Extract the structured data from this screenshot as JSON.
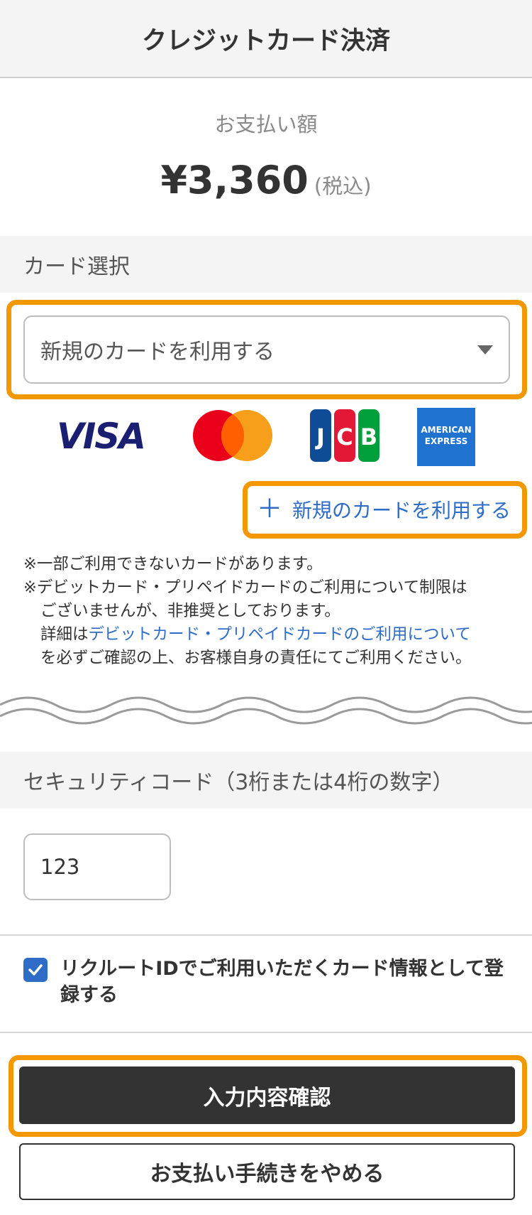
{
  "header": {
    "title": "クレジットカード決済"
  },
  "amount": {
    "label": "お支払い額",
    "value": "¥3,360",
    "tax": "(税込)"
  },
  "card_section": {
    "title": "カード選択",
    "select_value": "新規のカードを利用する",
    "brands": {
      "visa": "VISA",
      "amex_line1": "AMERICAN",
      "amex_line2": "EXPRESS"
    },
    "new_card_link": "新規のカードを利用する",
    "notes": {
      "line1": "※一部ご利用できないカードがあります。",
      "line2": "※デビットカード・プリペイドカードのご利用について制限は",
      "line3": "ございませんが、非推奨としております。",
      "line4_prefix": "詳細は",
      "line4_link": "デビットカード・プリペイドカードのご利用について",
      "line5": "を必ずご確認の上、お客様自身の責任にてご利用ください。"
    }
  },
  "security": {
    "title": "セキュリティコード（3桁または4桁の数字）",
    "value": "123"
  },
  "register": {
    "label": "リクルートIDでご利用いただくカード情報として登録する",
    "checked": true
  },
  "buttons": {
    "confirm": "入力内容確認",
    "cancel": "お支払い手続きをやめる"
  },
  "colors": {
    "highlight": "#f39800",
    "link": "#2e6cc7",
    "primary_button": "#333333"
  }
}
